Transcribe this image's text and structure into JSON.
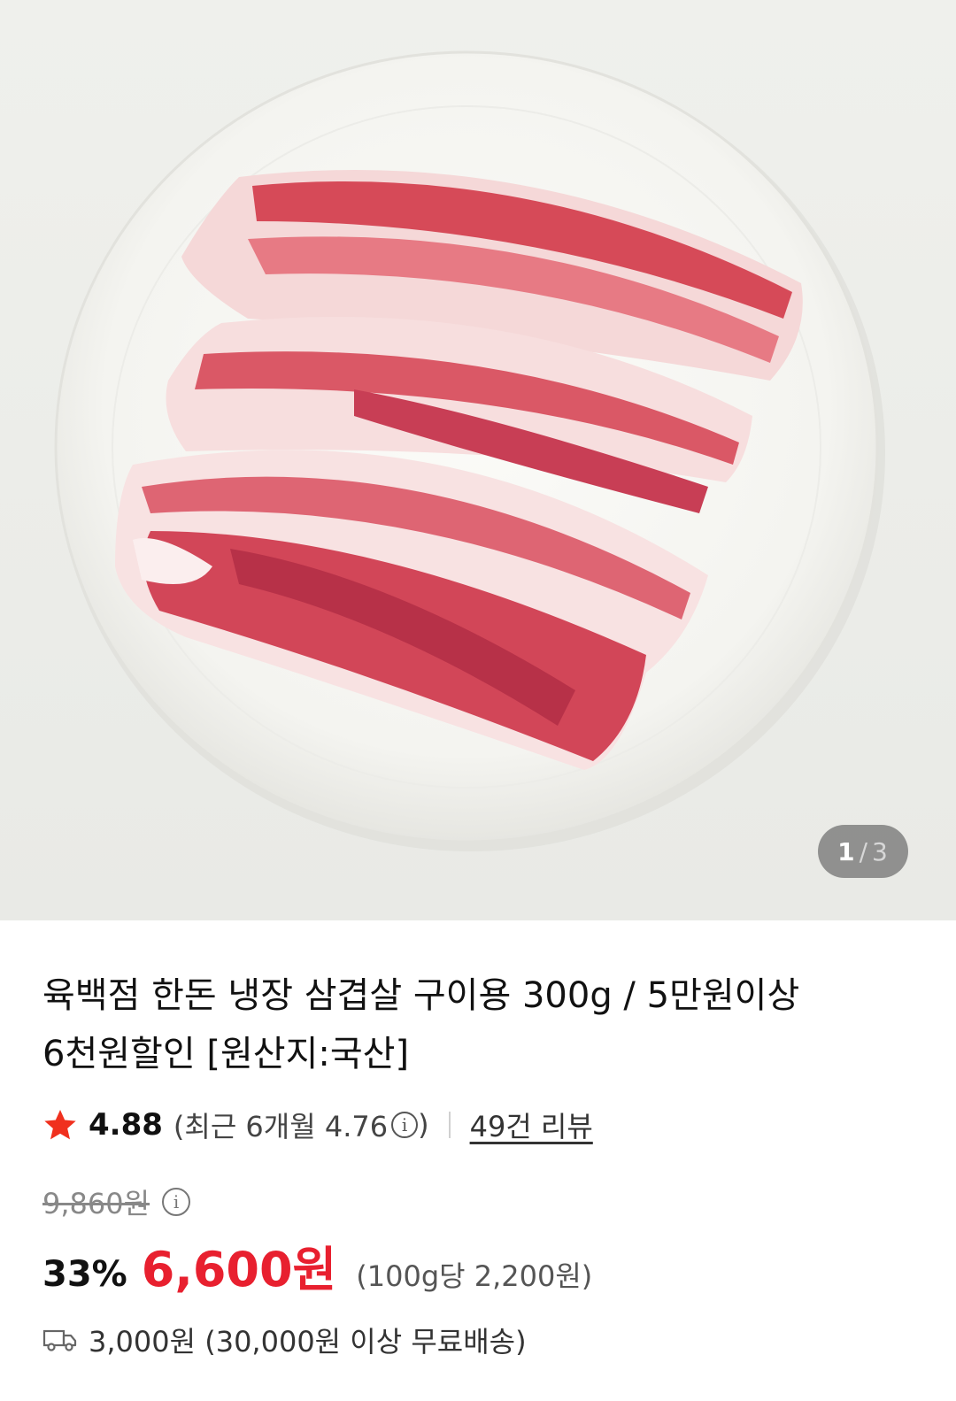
{
  "gallery": {
    "current": "1",
    "separator": "/",
    "total": "3"
  },
  "product": {
    "title_line1": "육백점 한돈 냉장 삼겹살 구이용 300g / 5만원이상",
    "title_line2": "6천원할인 [원산지:국산]"
  },
  "rating": {
    "score": "4.88",
    "recent_text": "(최근 6개월 4.76",
    "recent_close": ")",
    "review_link": "49건 리뷰"
  },
  "price": {
    "original": "9,860원",
    "discount_rate": "33%",
    "sale": "6,600원",
    "unit_price": "(100g당 2,200원)"
  },
  "shipping": {
    "text": "3,000원 (30,000원 이상 무료배송)"
  },
  "colors": {
    "accent": "#e8202f",
    "star": "#f0301e"
  },
  "icons": {
    "star": "star-icon",
    "info": "info-icon",
    "truck": "truck-icon"
  }
}
